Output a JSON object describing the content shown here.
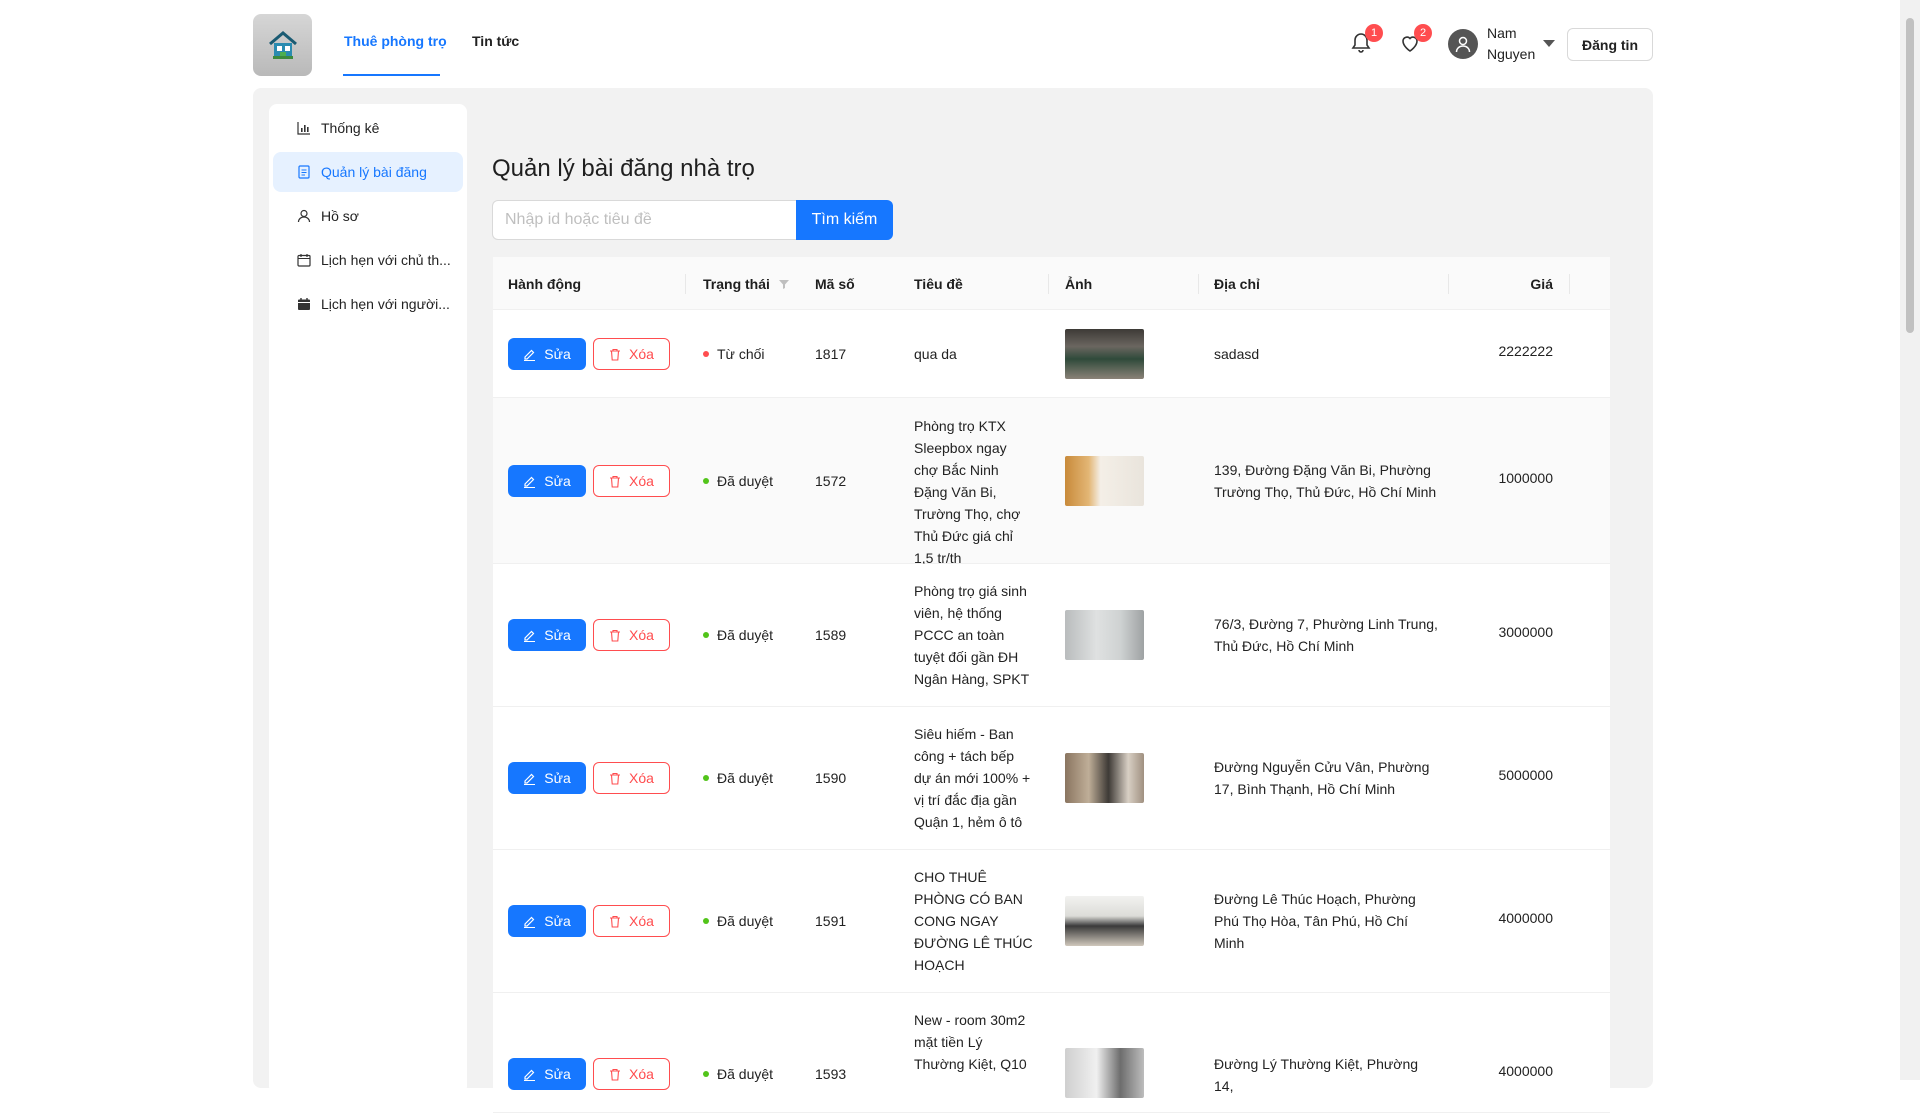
{
  "header": {
    "nav": [
      "Thuê phòng trọ",
      "Tin tức"
    ],
    "notifications_count": "1",
    "favorites_count": "2",
    "username": "Nam Nguyen",
    "post_button": "Đăng tin",
    "logo_icon": "house-logo-icon",
    "accent": "#1677ff"
  },
  "sidebar": {
    "items": [
      {
        "label": "Thống kê",
        "icon": "bar-chart-icon"
      },
      {
        "label": "Quản lý bài đăng",
        "icon": "document-icon"
      },
      {
        "label": "Hồ sơ",
        "icon": "user-icon"
      },
      {
        "label": "Lịch hẹn với chủ th...",
        "icon": "calendar-icon"
      },
      {
        "label": "Lịch hẹn với người...",
        "icon": "calendar-filled-icon"
      }
    ]
  },
  "main": {
    "title": "Quản lý bài đăng nhà trọ",
    "search": {
      "placeholder": "Nhập id hoặc tiêu đề",
      "value": "",
      "button": "Tìm kiếm"
    },
    "columns": {
      "action": "Hành động",
      "status": "Trạng thái",
      "id": "Mã số",
      "title": "Tiêu đề",
      "image": "Ảnh",
      "address": "Địa chỉ",
      "price": "Giá"
    },
    "edit_label": "Sửa",
    "delete_label": "Xóa",
    "rows": [
      {
        "status": "Từ chối",
        "status_color": "#ff4d4f",
        "id": "1817",
        "title": "qua da",
        "address": "sadasd",
        "price": "2222222"
      },
      {
        "status": "Đã duyệt",
        "status_color": "#52c41a",
        "id": "1572",
        "title": "Phòng trọ KTX Sleepbox ngay chợ Bắc Ninh Đặng Văn Bi, Trường Thọ, chợ Thủ Đức giá chỉ 1,5 tr/th",
        "address": "139, Đường Đặng Văn Bi, Phường Trường Thọ, Thủ Đức, Hồ Chí Minh",
        "price": "1000000"
      },
      {
        "status": "Đã duyệt",
        "status_color": "#52c41a",
        "id": "1589",
        "title": "Phòng trọ giá sinh viên, hệ thống PCCC an toàn tuyệt đối gần ĐH Ngân Hàng, SPKT",
        "address": "76/3, Đường 7, Phường Linh Trung, Thủ Đức, Hồ Chí Minh",
        "price": "3000000"
      },
      {
        "status": "Đã duyệt",
        "status_color": "#52c41a",
        "id": "1590",
        "title": "Siêu hiếm - Ban công + tách bếp dự án mới 100% + vị trí đắc địa gần Quận 1, hẻm ô tô",
        "address": "Đường Nguyễn Cửu Vân, Phường 17, Bình Thạnh, Hồ Chí Minh",
        "price": "5000000"
      },
      {
        "status": "Đã duyệt",
        "status_color": "#52c41a",
        "id": "1591",
        "title": "CHO THUÊ PHÒNG CÓ BAN CONG NGAY ĐƯỜNG LÊ THÚC HOẠCH",
        "address": "Đường Lê Thúc Hoạch, Phường Phú Thọ Hòa, Tân Phú, Hồ Chí Minh",
        "price": "4000000"
      },
      {
        "status": "Đã duyệt",
        "status_color": "#52c41a",
        "id": "1593",
        "title": "New - room 30m2 mặt tiền Lý Thường Kiệt, Q10",
        "address": "Đường Lý Thường Kiệt, Phường 14,",
        "price": "4000000"
      }
    ]
  }
}
